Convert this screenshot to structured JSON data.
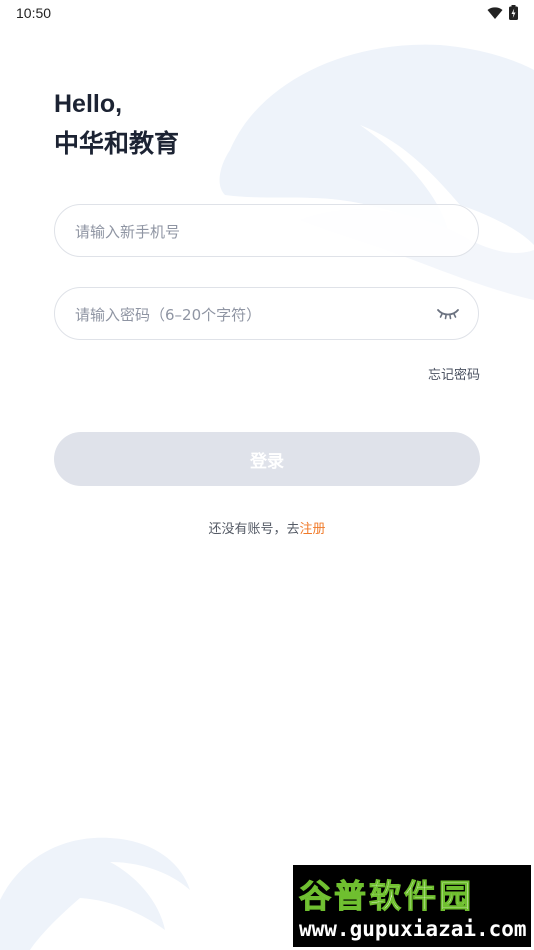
{
  "status_bar": {
    "time": "10:50",
    "icons": [
      "wifi-icon",
      "battery-icon"
    ]
  },
  "greeting": {
    "line1": "Hello,",
    "line2": "中华和教育"
  },
  "phone_field": {
    "placeholder": "请输入新手机号",
    "value": ""
  },
  "password_field": {
    "placeholder": "请输入密码（6–20个字符）",
    "value": "",
    "toggle_icon": "eye-closed-icon"
  },
  "forgot_password": "忘记密码",
  "login_button": "登录",
  "register": {
    "prompt": "还没有账号，去",
    "link": "注册"
  },
  "watermark": {
    "title_part1": "谷普",
    "title_part2": "软件园",
    "url": "www.gupuxiazai.com"
  },
  "colors": {
    "accent": "#f07a2a",
    "button_disabled": "#dfe2ea",
    "decor": "#eef3fa"
  }
}
